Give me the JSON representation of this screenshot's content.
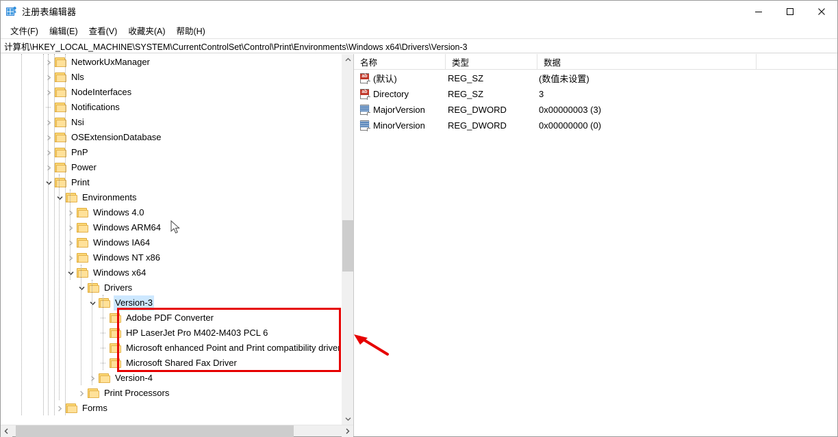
{
  "window": {
    "title": "注册表编辑器",
    "app_icon": "registry-editor-icon",
    "minimize_label": "—",
    "maximize_label": "□",
    "close_label": "✕"
  },
  "menubar": {
    "items": [
      {
        "label": "文件(F)",
        "name": "menu-file"
      },
      {
        "label": "编辑(E)",
        "name": "menu-edit"
      },
      {
        "label": "查看(V)",
        "name": "menu-view"
      },
      {
        "label": "收藏夹(A)",
        "name": "menu-favorites"
      },
      {
        "label": "帮助(H)",
        "name": "menu-help"
      }
    ]
  },
  "address": {
    "path": "计算机\\HKEY_LOCAL_MACHINE\\SYSTEM\\CurrentControlSet\\Control\\Print\\Environments\\Windows x64\\Drivers\\Version-3"
  },
  "tree": {
    "items": [
      {
        "label": "NetworkUxManager",
        "depth": 3,
        "state": "collapsed",
        "selected": false,
        "boxed": false
      },
      {
        "label": "Nls",
        "depth": 3,
        "state": "collapsed",
        "selected": false,
        "boxed": false
      },
      {
        "label": "NodeInterfaces",
        "depth": 3,
        "state": "collapsed",
        "selected": false,
        "boxed": false
      },
      {
        "label": "Notifications",
        "depth": 3,
        "state": "leaf",
        "selected": false,
        "boxed": false
      },
      {
        "label": "Nsi",
        "depth": 3,
        "state": "collapsed",
        "selected": false,
        "boxed": false
      },
      {
        "label": "OSExtensionDatabase",
        "depth": 3,
        "state": "collapsed",
        "selected": false,
        "boxed": false
      },
      {
        "label": "PnP",
        "depth": 3,
        "state": "collapsed",
        "selected": false,
        "boxed": false
      },
      {
        "label": "Power",
        "depth": 3,
        "state": "collapsed",
        "selected": false,
        "boxed": false
      },
      {
        "label": "Print",
        "depth": 3,
        "state": "expanded",
        "selected": false,
        "boxed": false
      },
      {
        "label": "Environments",
        "depth": 4,
        "state": "expanded",
        "selected": false,
        "boxed": false
      },
      {
        "label": "Windows 4.0",
        "depth": 5,
        "state": "collapsed",
        "selected": false,
        "boxed": false
      },
      {
        "label": "Windows ARM64",
        "depth": 5,
        "state": "collapsed",
        "selected": false,
        "boxed": false
      },
      {
        "label": "Windows IA64",
        "depth": 5,
        "state": "collapsed",
        "selected": false,
        "boxed": false
      },
      {
        "label": "Windows NT x86",
        "depth": 5,
        "state": "collapsed",
        "selected": false,
        "boxed": false
      },
      {
        "label": "Windows x64",
        "depth": 5,
        "state": "expanded",
        "selected": false,
        "boxed": false
      },
      {
        "label": "Drivers",
        "depth": 6,
        "state": "expanded",
        "selected": false,
        "boxed": false
      },
      {
        "label": "Version-3",
        "depth": 7,
        "state": "expanded",
        "selected": true,
        "boxed": false
      },
      {
        "label": "Adobe PDF Converter",
        "depth": 8,
        "state": "leaf",
        "selected": false,
        "boxed": true
      },
      {
        "label": "HP LaserJet Pro M402-M403 PCL 6",
        "depth": 8,
        "state": "leaf",
        "selected": false,
        "boxed": true
      },
      {
        "label": "Microsoft enhanced Point and Print compatibility driver",
        "depth": 8,
        "state": "leaf",
        "selected": false,
        "boxed": true
      },
      {
        "label": "Microsoft Shared Fax Driver",
        "depth": 8,
        "state": "leaf",
        "selected": false,
        "boxed": true
      },
      {
        "label": "Version-4",
        "depth": 7,
        "state": "collapsed",
        "selected": false,
        "boxed": false
      },
      {
        "label": "Print Processors",
        "depth": 6,
        "state": "collapsed",
        "selected": false,
        "boxed": false
      },
      {
        "label": "Forms",
        "depth": 4,
        "state": "collapsed",
        "selected": false,
        "boxed": false
      }
    ]
  },
  "list": {
    "columns": [
      {
        "label": "名称",
        "name": "column-name"
      },
      {
        "label": "类型",
        "name": "column-type"
      },
      {
        "label": "数据",
        "name": "column-data"
      }
    ],
    "rows": [
      {
        "icon": "string-value-icon",
        "icon_kind": "sz",
        "name": "(默认)",
        "type": "REG_SZ",
        "data": "(数值未设置)"
      },
      {
        "icon": "string-value-icon",
        "icon_kind": "sz",
        "name": "Directory",
        "type": "REG_SZ",
        "data": "3"
      },
      {
        "icon": "dword-value-icon",
        "icon_kind": "dword",
        "name": "MajorVersion",
        "type": "REG_DWORD",
        "data": "0x00000003 (3)"
      },
      {
        "icon": "dword-value-icon",
        "icon_kind": "dword",
        "name": "MinorVersion",
        "type": "REG_DWORD",
        "data": "0x00000000 (0)"
      }
    ]
  },
  "annotations": {
    "highlight_box_color": "#e60000",
    "arrow_color": "#e60000",
    "selection_color": "#cde8ff"
  },
  "scrollbars": {
    "tree_vertical_up": "▲",
    "tree_vertical_down": "▼",
    "tree_horizontal_left": "◀",
    "tree_horizontal_right": "▶"
  }
}
